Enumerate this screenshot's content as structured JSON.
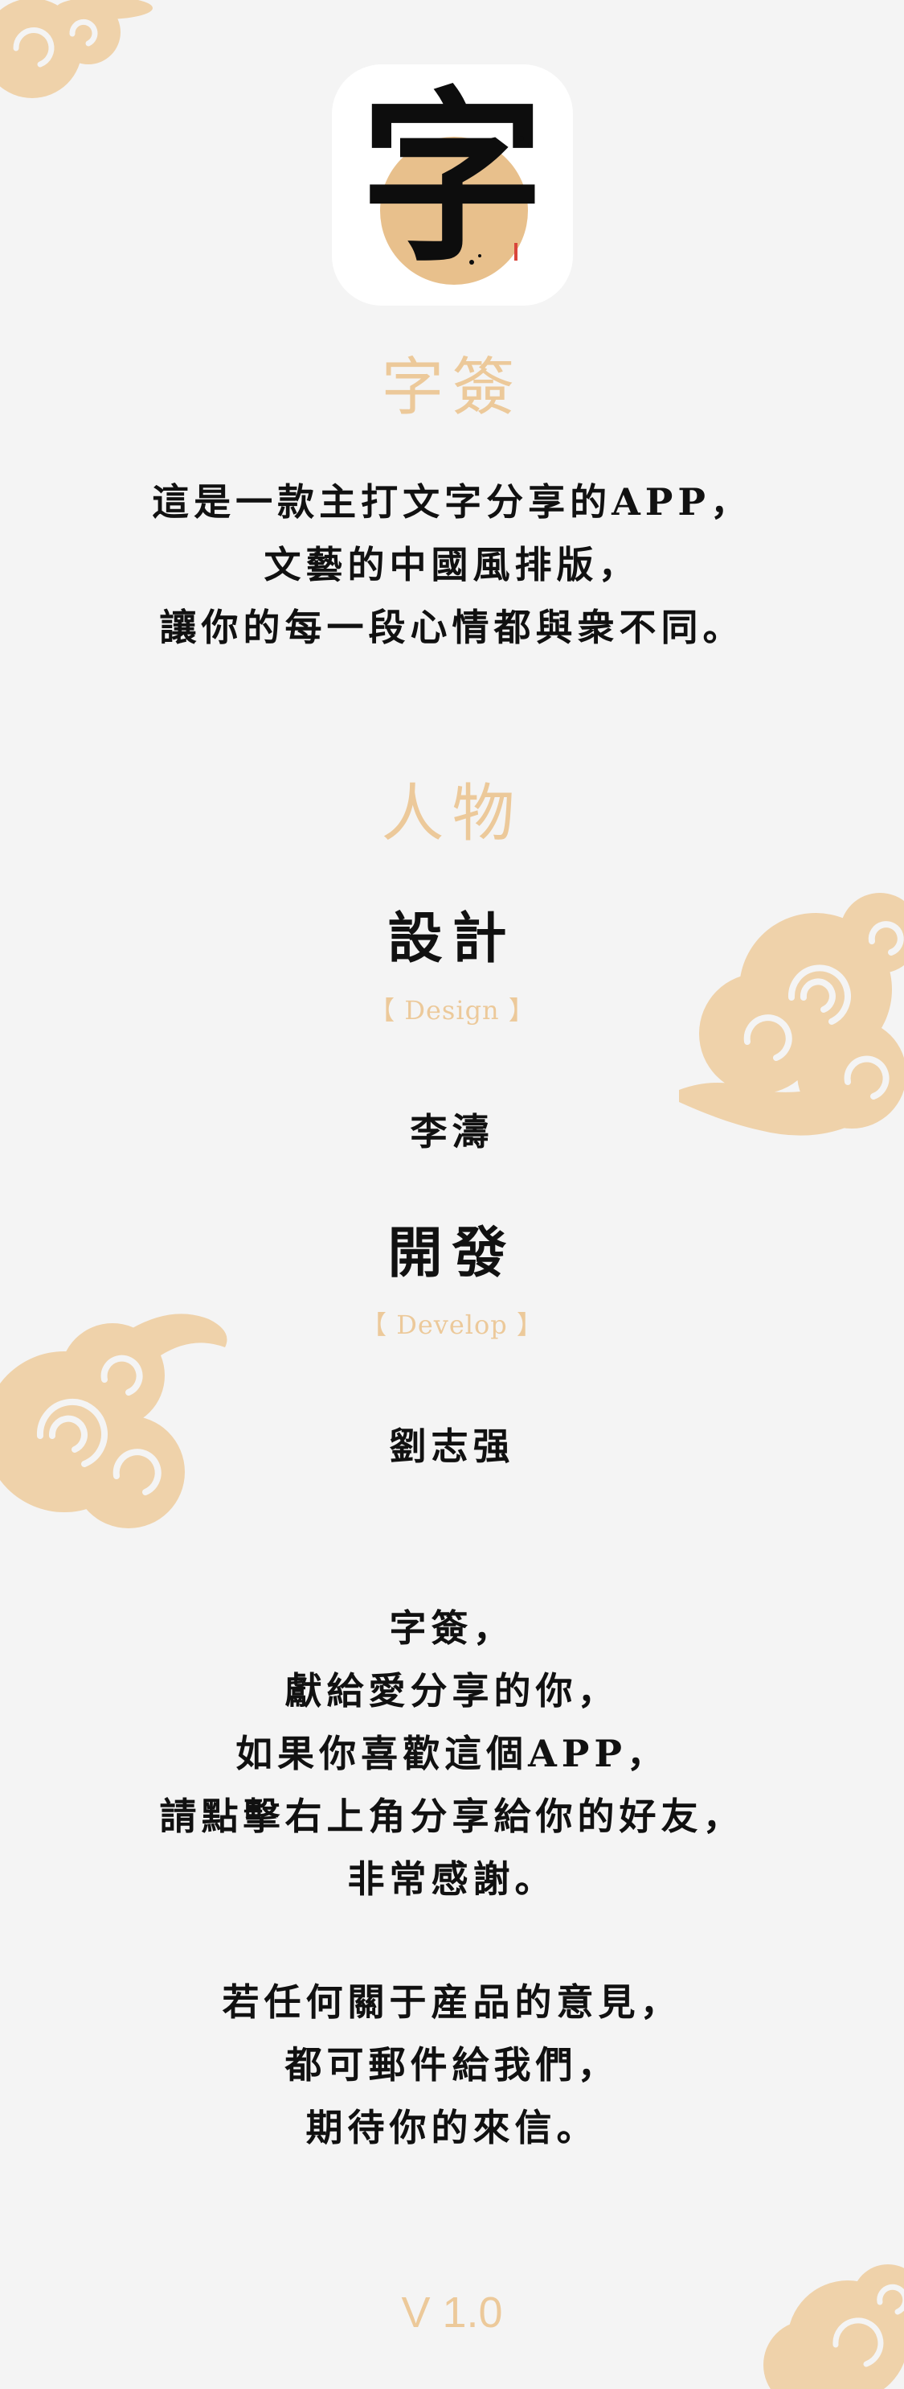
{
  "app": {
    "icon_glyph": "字",
    "name": "字簽",
    "intro_lines": [
      "這是一款主打文字分享的APP，",
      "文藝的中國風排版，",
      "讓你的每一段心情都與衆不同。"
    ]
  },
  "people": {
    "title": "人物",
    "roles": [
      {
        "title": "設計",
        "subtitle": "【 Design 】",
        "person": "李濤"
      },
      {
        "title": "開發",
        "subtitle": "【 Develop 】",
        "person": "劉志强"
      }
    ]
  },
  "dedication_lines": [
    "字簽，",
    "獻給愛分享的你，",
    "如果你喜歡這個APP，",
    "請點擊右上角分享給你的好友，",
    "非常感謝。"
  ],
  "feedback_lines": [
    "若任何關于産品的意見，",
    "都可郵件給我們，",
    "期待你的來信。"
  ],
  "version": "V 1.0",
  "colors": {
    "accent": "#ecc99a",
    "background": "#f4f4f4",
    "text": "#111111",
    "stamp": "#d9463b"
  }
}
